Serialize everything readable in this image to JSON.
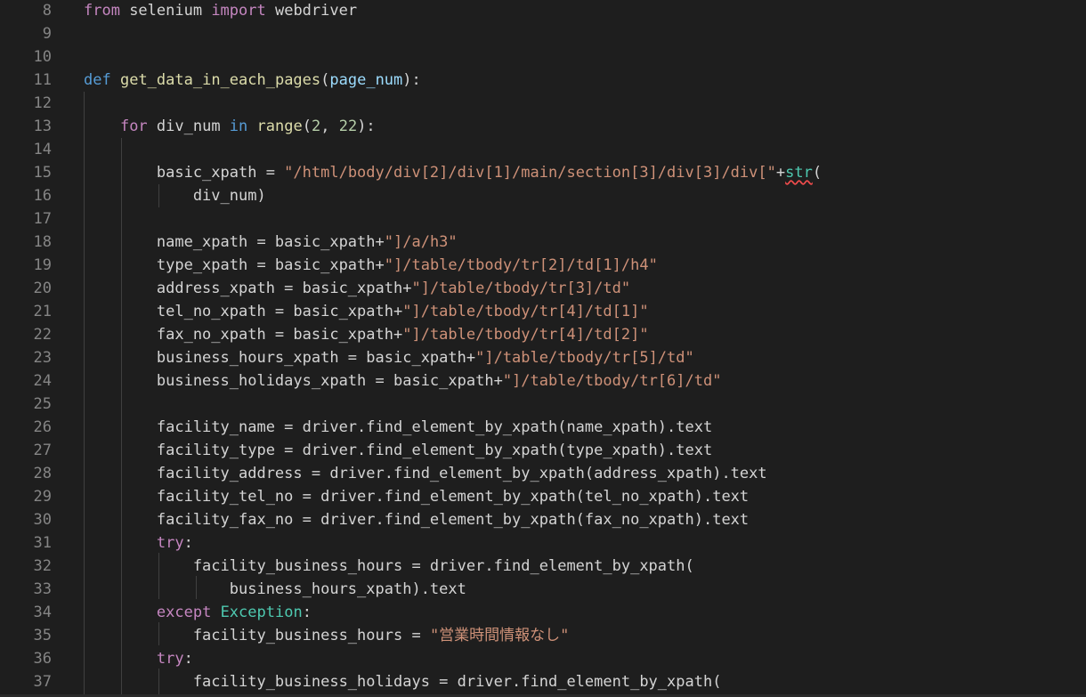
{
  "colors": {
    "background": "#1e1e1e",
    "text": "#d4d4d4",
    "line_number": "#858585",
    "keyword_control": "#c586c0",
    "keyword_def": "#569cd6",
    "function": "#dcdcaa",
    "parameter": "#9cdcfe",
    "string": "#ce9178",
    "number": "#b5cea8",
    "class": "#4ec9b0",
    "error_squiggle": "#f14c4c"
  },
  "lines": [
    {
      "num": "8",
      "tokens": [
        {
          "t": "from",
          "c": "keyword_control"
        },
        {
          "t": " selenium "
        },
        {
          "t": "import",
          "c": "keyword_control"
        },
        {
          "t": " webdriver"
        }
      ]
    },
    {
      "num": "9",
      "tokens": []
    },
    {
      "num": "10",
      "tokens": []
    },
    {
      "num": "11",
      "tokens": [
        {
          "t": "def",
          "c": "keyword_def"
        },
        {
          "t": " "
        },
        {
          "t": "get_data_in_each_pages",
          "c": "function"
        },
        {
          "t": "("
        },
        {
          "t": "page_num",
          "c": "parameter"
        },
        {
          "t": "):"
        }
      ]
    },
    {
      "num": "12",
      "tokens": []
    },
    {
      "num": "13",
      "tokens": [
        {
          "t": "    "
        },
        {
          "t": "for",
          "c": "keyword_control"
        },
        {
          "t": " div_num "
        },
        {
          "t": "in",
          "c": "keyword_def"
        },
        {
          "t": " "
        },
        {
          "t": "range",
          "c": "function"
        },
        {
          "t": "("
        },
        {
          "t": "2",
          "c": "number"
        },
        {
          "t": ", "
        },
        {
          "t": "22",
          "c": "number"
        },
        {
          "t": "):"
        }
      ]
    },
    {
      "num": "14",
      "tokens": []
    },
    {
      "num": "15",
      "tokens": [
        {
          "t": "        basic_xpath = "
        },
        {
          "t": "\"/html/body/div[2]/div[1]/main/section[3]/div[3]/div[\"",
          "c": "string"
        },
        {
          "t": "+"
        },
        {
          "t": "str",
          "c": "class",
          "squiggle": true
        },
        {
          "t": "("
        }
      ]
    },
    {
      "num": "16",
      "tokens": [
        {
          "t": "            div_num)"
        }
      ]
    },
    {
      "num": "17",
      "tokens": []
    },
    {
      "num": "18",
      "tokens": [
        {
          "t": "        name_xpath = basic_xpath+"
        },
        {
          "t": "\"]/a/h3\"",
          "c": "string"
        }
      ]
    },
    {
      "num": "19",
      "tokens": [
        {
          "t": "        type_xpath = basic_xpath+"
        },
        {
          "t": "\"]/table/tbody/tr[2]/td[1]/h4\"",
          "c": "string"
        }
      ]
    },
    {
      "num": "20",
      "tokens": [
        {
          "t": "        address_xpath = basic_xpath+"
        },
        {
          "t": "\"]/table/tbody/tr[3]/td\"",
          "c": "string"
        }
      ]
    },
    {
      "num": "21",
      "tokens": [
        {
          "t": "        tel_no_xpath = basic_xpath+"
        },
        {
          "t": "\"]/table/tbody/tr[4]/td[1]\"",
          "c": "string"
        }
      ]
    },
    {
      "num": "22",
      "tokens": [
        {
          "t": "        fax_no_xpath = basic_xpath+"
        },
        {
          "t": "\"]/table/tbody/tr[4]/td[2]\"",
          "c": "string"
        }
      ]
    },
    {
      "num": "23",
      "tokens": [
        {
          "t": "        business_hours_xpath = basic_xpath+"
        },
        {
          "t": "\"]/table/tbody/tr[5]/td\"",
          "c": "string"
        }
      ]
    },
    {
      "num": "24",
      "tokens": [
        {
          "t": "        business_holidays_xpath = basic_xpath+"
        },
        {
          "t": "\"]/table/tbody/tr[6]/td\"",
          "c": "string"
        }
      ]
    },
    {
      "num": "25",
      "tokens": []
    },
    {
      "num": "26",
      "tokens": [
        {
          "t": "        facility_name = driver.find_element_by_xpath(name_xpath).text"
        }
      ]
    },
    {
      "num": "27",
      "tokens": [
        {
          "t": "        facility_type = driver.find_element_by_xpath(type_xpath).text"
        }
      ]
    },
    {
      "num": "28",
      "tokens": [
        {
          "t": "        facility_address = driver.find_element_by_xpath(address_xpath).text"
        }
      ]
    },
    {
      "num": "29",
      "tokens": [
        {
          "t": "        facility_tel_no = driver.find_element_by_xpath(tel_no_xpath).text"
        }
      ]
    },
    {
      "num": "30",
      "tokens": [
        {
          "t": "        facility_fax_no = driver.find_element_by_xpath(fax_no_xpath).text"
        }
      ]
    },
    {
      "num": "31",
      "tokens": [
        {
          "t": "        "
        },
        {
          "t": "try",
          "c": "keyword_control"
        },
        {
          "t": ":"
        }
      ]
    },
    {
      "num": "32",
      "tokens": [
        {
          "t": "            facility_business_hours = driver.find_element_by_xpath("
        }
      ]
    },
    {
      "num": "33",
      "tokens": [
        {
          "t": "                business_hours_xpath).text"
        }
      ]
    },
    {
      "num": "34",
      "tokens": [
        {
          "t": "        "
        },
        {
          "t": "except",
          "c": "keyword_control"
        },
        {
          "t": " "
        },
        {
          "t": "Exception",
          "c": "class"
        },
        {
          "t": ":"
        }
      ]
    },
    {
      "num": "35",
      "tokens": [
        {
          "t": "            facility_business_hours = "
        },
        {
          "t": "\"営業時間情報なし\"",
          "c": "string"
        }
      ]
    },
    {
      "num": "36",
      "tokens": [
        {
          "t": "        "
        },
        {
          "t": "try",
          "c": "keyword_control"
        },
        {
          "t": ":"
        }
      ]
    },
    {
      "num": "37",
      "tokens": [
        {
          "t": "            facility_business_holidays = driver.find_element_by_xpath("
        }
      ]
    }
  ]
}
